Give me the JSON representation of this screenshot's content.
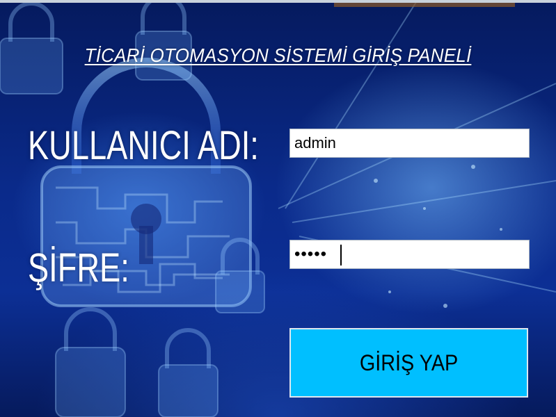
{
  "title": "TİCARİ OTOMASYON SİSTEMİ GİRİŞ PANELİ",
  "form": {
    "username_label": "KULLANICI ADI:",
    "username_value": "admin",
    "password_label": "ŞİFRE:",
    "password_value": "•••••",
    "login_button": "GİRİŞ YAP"
  },
  "colors": {
    "button": "#00bfff",
    "background": "#0a2a8a",
    "text": "#ffffff"
  },
  "icons": {
    "background_motif": "padlock-icon"
  }
}
